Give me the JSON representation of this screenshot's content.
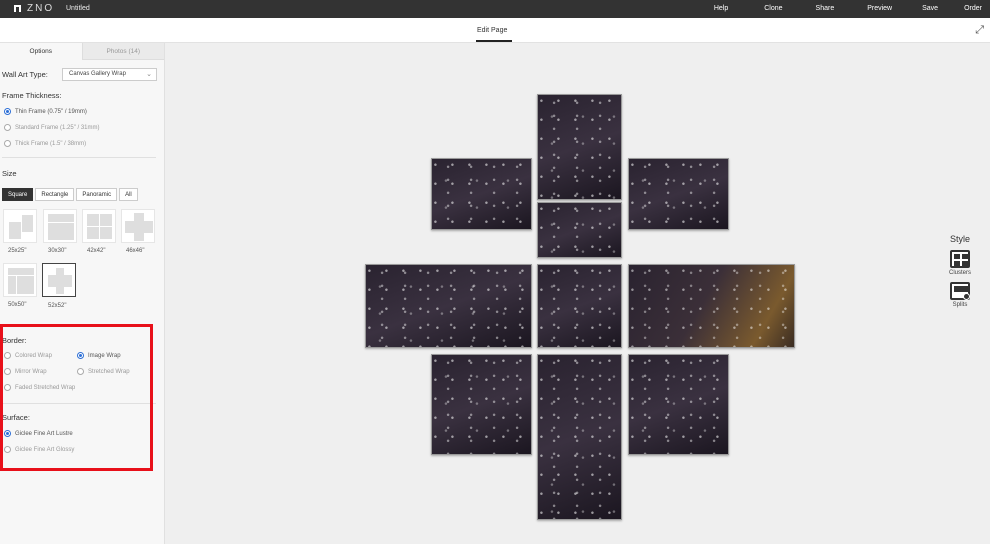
{
  "app": {
    "logo_text": "ZNO",
    "doc_title": "Untitled",
    "nav": [
      "Help",
      "Clone",
      "Share",
      "Preview",
      "Save",
      "Order"
    ]
  },
  "subbar": {
    "title": "Edit Page",
    "expand_icon": "expand-icon"
  },
  "sidebar": {
    "tabs": [
      "Options",
      "Photos (14)"
    ],
    "wall_art_type": {
      "label": "Wall Art Type:",
      "value": "Canvas Gallery Wrap"
    },
    "frame_thickness": {
      "label": "Frame Thickness:",
      "options": [
        "Thin Frame (0.75\" / 19mm)",
        "Standard Frame (1.25\" / 31mm)",
        "Thick Frame (1.5\" / 38mm)"
      ],
      "selected": 0
    },
    "size": {
      "label": "Size",
      "buttons": [
        "Square",
        "Rectangle",
        "Panoramic",
        "All"
      ],
      "active": "Square",
      "thumbs": [
        "25x25\"",
        "30x30\"",
        "42x42\"",
        "46x46\"",
        "50x50\"",
        "52x52\""
      ],
      "selected_thumb": "52x52\""
    },
    "border": {
      "label": "Border:",
      "options": [
        "Colored Wrap",
        "Image Wrap",
        "Mirror Wrap",
        "Stretched Wrap",
        "Faded Stretched Wrap"
      ],
      "selected": "Image Wrap"
    },
    "surface": {
      "label": "Surface:",
      "options": [
        "Giclee Fine Art Lustre",
        "Giclee Fine Art Glossy"
      ],
      "selected": "Giclee Fine Art Lustre"
    }
  },
  "style_panel": {
    "title": "Style",
    "items": [
      {
        "label": "Clusters",
        "icon": "clusters-icon"
      },
      {
        "label": "Splits",
        "icon": "splits-icon"
      }
    ]
  },
  "colors": {
    "topbar": "#333333",
    "highlight": "#e8101a",
    "radio": "#2d6fd6"
  }
}
